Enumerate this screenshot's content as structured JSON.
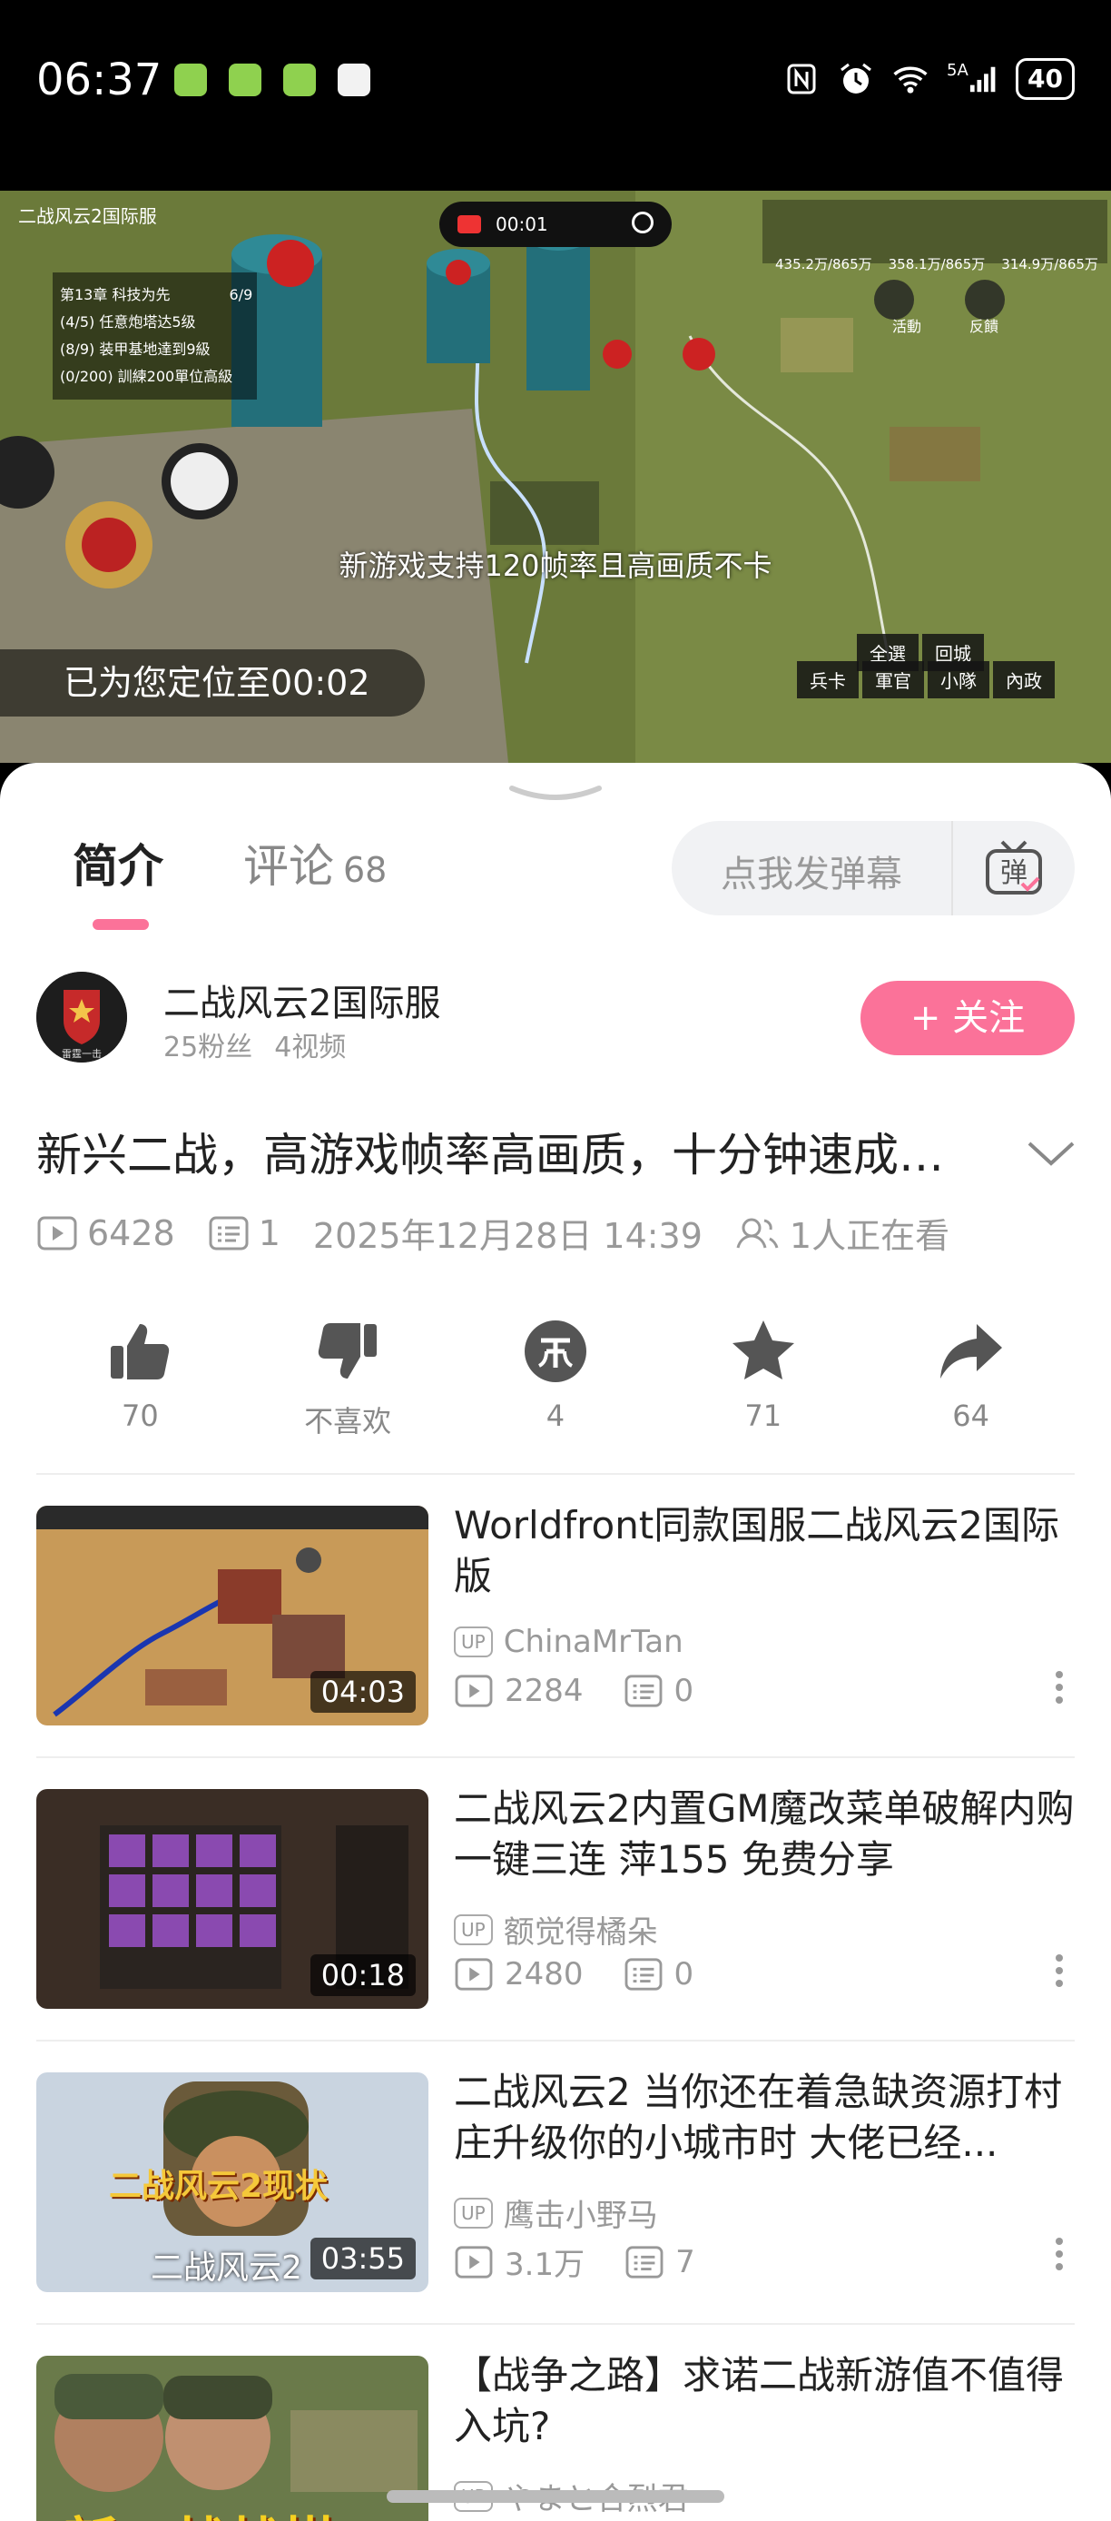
{
  "status_bar": {
    "time": "06:37",
    "signal_label": "5A",
    "battery": "40"
  },
  "player": {
    "game_header": "二战风云2国际服",
    "game_chapter": "第13章 科技为先",
    "game_chapter_progress": "6/9",
    "game_tasks": [
      "(4/5) 任意炮塔达5级",
      "(8/9) 装甲基地達到9級",
      "(0/200) 訓練200單位高級"
    ],
    "resource_bar": [
      "435.2万/865万",
      "358.1万/865万",
      "314.9万/865万"
    ],
    "rec_time": "00:01",
    "subtitle": "新游戏支持120帧率且高画质不卡",
    "located_toast": "已为您定位至00:02",
    "game_buttons": [
      "兵卡",
      "軍官",
      "小隊",
      "內政"
    ],
    "top_buttons": [
      "全選",
      "回城"
    ],
    "side_labels": [
      "活動",
      "反饋"
    ]
  },
  "tabs": {
    "intro_label": "简介",
    "comments_label": "评论",
    "comments_count": "68",
    "danmaku_placeholder": "点我发弹幕",
    "danmaku_icon_label": "弹"
  },
  "author": {
    "name": "二战风云2国际服",
    "fans": "25粉丝",
    "videos": "4视频",
    "avatar_text": "雷霆一击",
    "follow_label": "+ 关注"
  },
  "video": {
    "title": "新兴二战，高游戏帧率高画质，十分钟速成大佬级别打法",
    "views": "6428",
    "danmaku": "1",
    "date": "2025年12月28日 14:39",
    "watching": "1人正在看"
  },
  "actions": [
    {
      "name": "like",
      "label": "70"
    },
    {
      "name": "dislike",
      "label": "不喜欢"
    },
    {
      "name": "coin",
      "label": "4"
    },
    {
      "name": "favorite",
      "label": "71"
    },
    {
      "name": "share",
      "label": "64"
    }
  ],
  "recommendations": [
    {
      "title": "Worldfront同款国服二战风云2国际版",
      "up": "ChinaMrTan",
      "views": "2284",
      "danmaku": "0",
      "duration": "04:03"
    },
    {
      "title": "二战风云2内置GM魔改菜单破解内购 一键三连 萍155 免费分享",
      "up": "额觉得橘朵",
      "views": "2480",
      "danmaku": "0",
      "duration": "00:18"
    },
    {
      "title": "二战风云2 当你还在着急缺资源打村庄升级你的小城市时 大佬已经...",
      "up": "鹰击小野马",
      "views": "3.1万",
      "danmaku": "7",
      "duration": "03:55",
      "thumb_text_1": "二战风云2现状",
      "thumb_text_2": "二战风云2"
    },
    {
      "title": "【战争之路】求诺二战新游值不值得入坑?",
      "up": "やまと合烈君",
      "views": "",
      "danmaku": "",
      "duration": "",
      "thumb_text_1": "新二战战棋"
    }
  ]
}
